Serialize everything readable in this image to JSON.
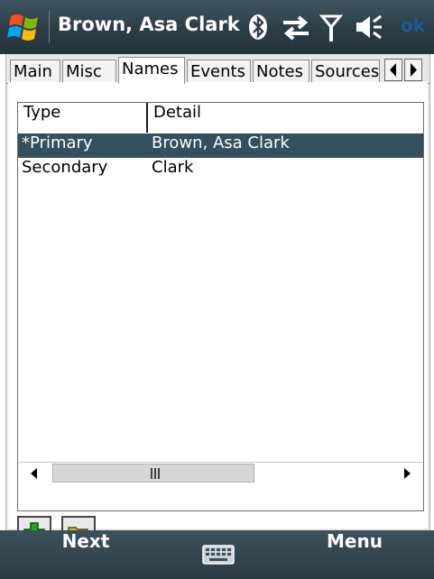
{
  "title_bar": {
    "title": "Brown, Asa Clark",
    "ok_label": "ok",
    "icons": [
      "windows-start-icon",
      "bluetooth-icon",
      "connectivity-icon",
      "signal-icon",
      "volume-icon"
    ]
  },
  "tabs": [
    {
      "label": "Main",
      "active": false
    },
    {
      "label": "Misc",
      "active": false
    },
    {
      "label": "Names",
      "active": true
    },
    {
      "label": "Events",
      "active": false
    },
    {
      "label": "Notes",
      "active": false
    },
    {
      "label": "Sources",
      "active": false
    }
  ],
  "list": {
    "columns": [
      "Type",
      "Detail"
    ],
    "rows": [
      {
        "type": "*Primary",
        "detail": "Brown, Asa Clark",
        "selected": true
      },
      {
        "type": "Secondary",
        "detail": "Clark",
        "selected": false
      }
    ]
  },
  "actions": {
    "icons": [
      "add-icon",
      "open-folder-icon"
    ]
  },
  "softkeys": {
    "left": "Next",
    "center_icon": "keyboard-icon",
    "right": "Menu"
  },
  "colors": {
    "title_bar": "#2f424d",
    "selection": "#32505e",
    "add_green": "#22aa22"
  }
}
